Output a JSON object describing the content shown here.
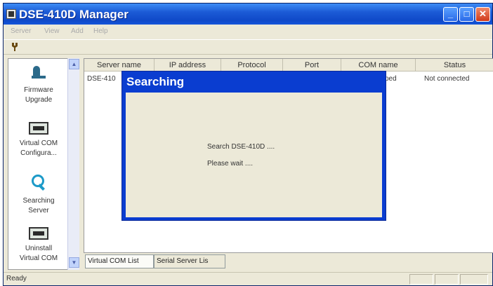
{
  "window": {
    "title": "DSE-410D Manager"
  },
  "titlebar_buttons": {
    "minimize": "_",
    "maximize": "□",
    "close": "✕"
  },
  "menu": [
    {
      "label": "Server"
    },
    {
      "label": "View"
    },
    {
      "label": "Add"
    },
    {
      "label": "Help"
    }
  ],
  "toolbar": {
    "icon": "wrench-icon"
  },
  "sidebar": {
    "items": [
      {
        "label_line1": "Firmware",
        "label_line2": "Upgrade",
        "icon": "firmware-upgrade-icon"
      },
      {
        "label_line1": "Virtual COM",
        "label_line2": "Configura...",
        "icon": "virtual-com-icon"
      },
      {
        "label_line1": "Searching",
        "label_line2": "Server",
        "icon": "search-icon"
      },
      {
        "label_line1": "Uninstall",
        "label_line2": "Virtual COM",
        "icon": "uninstall-com-icon"
      }
    ]
  },
  "table": {
    "columns": [
      "Server name",
      "IP address",
      "Protocol",
      "Port",
      "COM name",
      "Status"
    ],
    "rows": [
      {
        "server_name": "DSE-410",
        "com_name": "ped",
        "status": "Not connected"
      }
    ]
  },
  "tabs": [
    {
      "label": "Virtual COM List",
      "active": true
    },
    {
      "label": "Serial Server Lis",
      "active": false
    }
  ],
  "statusbar": {
    "text": "Ready"
  },
  "dialog": {
    "title": "Searching",
    "line1": "Search DSE-410D ....",
    "line2": "Please wait ...."
  },
  "colors": {
    "title_blue": "#1c5bd6",
    "dialog_blue": "#0a3dd0",
    "face": "#ece9d8"
  }
}
